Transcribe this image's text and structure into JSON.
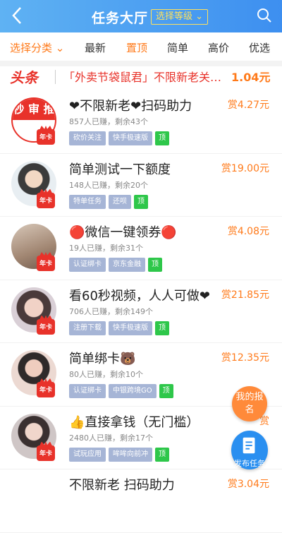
{
  "header": {
    "title": "任务大厅",
    "level_label": "选择等级"
  },
  "filters": [
    "选择分类",
    "最新",
    "置顶",
    "简单",
    "高价",
    "优选"
  ],
  "headline": {
    "logo": "头条",
    "text": "「外卖节袋鼠君」不限新老关…",
    "price": "1.04元"
  },
  "items": [
    {
      "title": "❤不限新老❤扫码助力",
      "price": "赏4.27元",
      "meta": "857人已赚，剩余43个",
      "tags": [
        "砍价关注",
        "快手极速版"
      ],
      "top": "顶",
      "badge": "年卡",
      "avatar_text": "秒 审 推 荐"
    },
    {
      "title": "简单测试一下额度",
      "price": "赏19.00元",
      "meta": "148人已赚，剩余20个",
      "tags": [
        "特单任务",
        "还呗"
      ],
      "top": "顶",
      "badge": "年卡"
    },
    {
      "title": "🔴微信一键领券🔴",
      "price": "赏4.08元",
      "meta": "19人已赚，剩余31个",
      "tags": [
        "认证绑卡",
        "京东金融"
      ],
      "top": "顶",
      "badge": "年卡"
    },
    {
      "title": "看60秒视频，人人可做❤",
      "price": "赏21.85元",
      "meta": "706人已赚，剩余149个",
      "tags": [
        "注册下载",
        "快手极速版"
      ],
      "top": "顶",
      "badge": "年卡"
    },
    {
      "title": "简单绑卡🐻",
      "price": "赏12.35元",
      "meta": "80人已赚，剩余10个",
      "tags": [
        "认证绑卡",
        "中银跨境GO"
      ],
      "top": "顶",
      "badge": "年卡"
    },
    {
      "title": "👍直接拿钱（无门槛）",
      "price": "赏",
      "meta": "2480人已赚，剩余17个",
      "tags": [
        "试玩应用",
        "哞哞向前冲"
      ],
      "top": "顶",
      "badge": "年卡"
    },
    {
      "title": "不限新老 扫码助力",
      "price": "赏3.04元",
      "meta": "",
      "tags": [],
      "top": "",
      "badge": ""
    }
  ],
  "float_buttons": {
    "my_signup": "我的报名",
    "post_task": "发布任务"
  },
  "colors": {
    "accent": "#ff7a1a",
    "header": "#3d8ff0",
    "tag": "#a6b5d6",
    "top_tag": "#2ec74a"
  }
}
